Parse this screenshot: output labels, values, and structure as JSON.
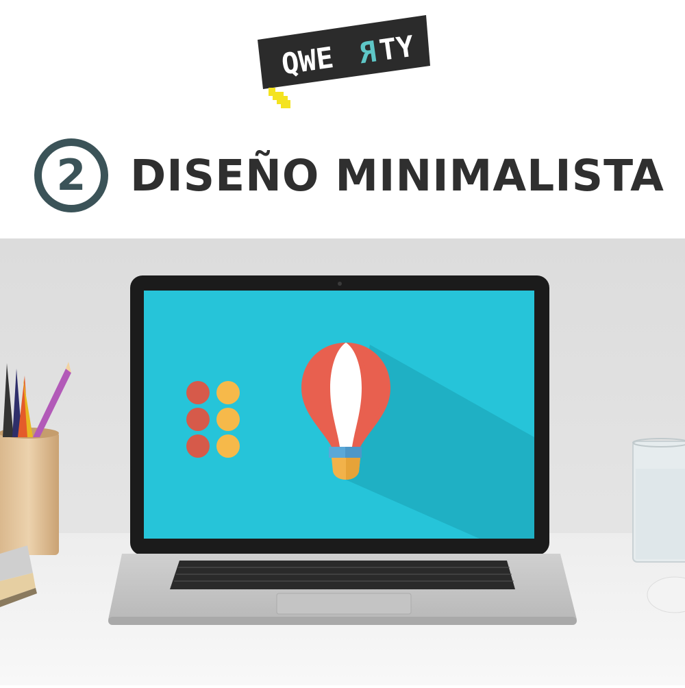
{
  "logo": {
    "text": "QWERTY",
    "prefix": "QWE",
    "mirrored_letter": "R",
    "suffix": "TY",
    "colors": {
      "box": "#2b2b2b",
      "text": "#ffffff",
      "accent": "#5ec6c6",
      "tail": "#f4e320"
    }
  },
  "heading": {
    "step_number": "2",
    "title": "DISEÑO MINIMALISTA",
    "colors": {
      "ring": "#3b5358",
      "title": "#2f2f2f"
    }
  },
  "photo": {
    "scene": "laptop-on-desk",
    "screen_color": "#26c4d9",
    "dot_colors": {
      "left": "#d65a4a",
      "right": "#f6b94a"
    },
    "balloon_colors": {
      "red": "#e8604f",
      "white": "#ffffff",
      "band": "#5aa8d8",
      "basket": "#f2b24a"
    }
  }
}
